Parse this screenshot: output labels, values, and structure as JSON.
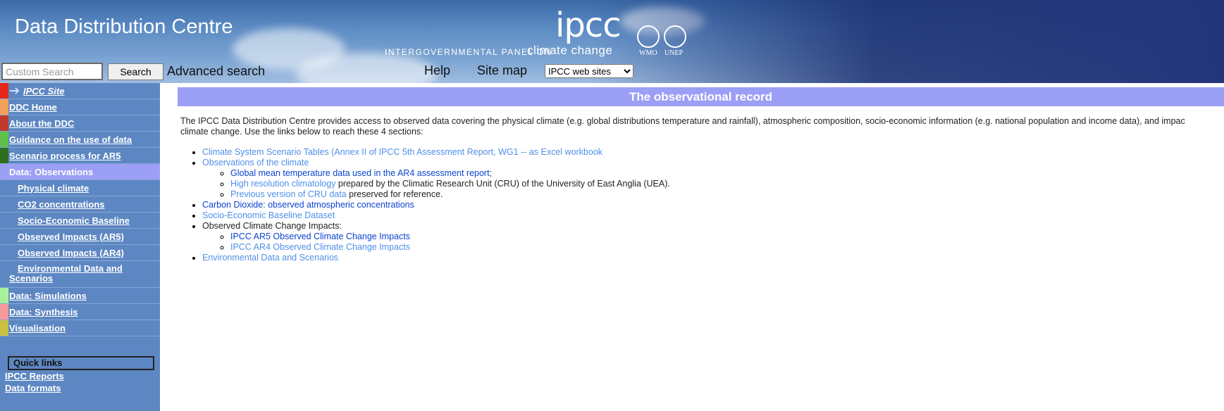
{
  "header": {
    "site_title": "Data Distribution Centre",
    "search_placeholder": "Custom Search",
    "search_button": "Search",
    "advanced_search": "Advanced search",
    "logo_text": "ipcc",
    "logo_tagline": "INTERGOVERNMENTAL PANEL ON",
    "logo_tagline_big": "climate change",
    "org_logos": [
      "WMO",
      "UNEP"
    ],
    "nav_help": "Help",
    "nav_sitemap": "Site map",
    "sites_select_value": "IPCC web sites"
  },
  "sidebar": {
    "items": [
      {
        "label": "IPCC Site",
        "strip": "#e8261e"
      },
      {
        "label": "DDC Home",
        "strip": "#f2a15c"
      },
      {
        "label": "About the DDC",
        "strip": "#c0392b"
      },
      {
        "label": "Guidance on the use of data",
        "strip": "#5cc04a"
      },
      {
        "label": "Scenario process for AR5",
        "strip": "#2d6e1f"
      },
      {
        "label": "Data: Observations",
        "strip": "#9b9ff5"
      },
      {
        "label": "Physical climate"
      },
      {
        "label": "CO2 concentrations"
      },
      {
        "label": "Socio-Economic Baseline"
      },
      {
        "label": "Observed Impacts (AR5)"
      },
      {
        "label": "Observed Impacts (AR4)"
      },
      {
        "label": "Environmental Data and Scenarios"
      },
      {
        "label": "Data: Simulations",
        "strip": "#a8f09a"
      },
      {
        "label": "Data: Synthesis",
        "strip": "#f59a9a"
      },
      {
        "label": "Visualisation",
        "strip": "#c9c040"
      }
    ],
    "quick_links_title": "Quick links",
    "quick_links": [
      "IPCC Reports",
      "Data formats"
    ]
  },
  "main": {
    "title": "The observational record",
    "intro_line1": "The IPCC Data Distribution Centre provides access to observed data covering the physical climate (e.g. global distributions temperature and rainfall), atmospheric composition, socio-economic information (e.g. national population and income data), and impac",
    "intro_line2": "climate change. Use the links below to reach these 4 sections:",
    "links": {
      "scenario_tables": "Climate System Scenario Tables (Annex II of IPCC 5th Assessment Report, WG1 -- as Excel workbook",
      "observations": "Observations of the climate",
      "global_mean": "Global mean temperature data used in the AR4 assessment report;",
      "high_res": "High resolution climatology",
      "high_res_suffix": " prepared by the Climatic Research Unit (CRU) of the University of East Anglia (UEA).",
      "previous_cru": "Previous version of CRU data",
      "previous_cru_suffix": " preserved for reference.",
      "co2": "Carbon Dioxide: observed atmospheric concentrations",
      "socio": "Socio-Economic Baseline Dataset",
      "impacts_label": "Observed Climate Change Impacts:",
      "ar5_impacts": "IPCC AR5 Observed Climate Change Impacts",
      "ar4_impacts": "IPCC AR4 Observed Climate Change Impacts",
      "env_data": "Environmental Data and Scenarios"
    }
  }
}
